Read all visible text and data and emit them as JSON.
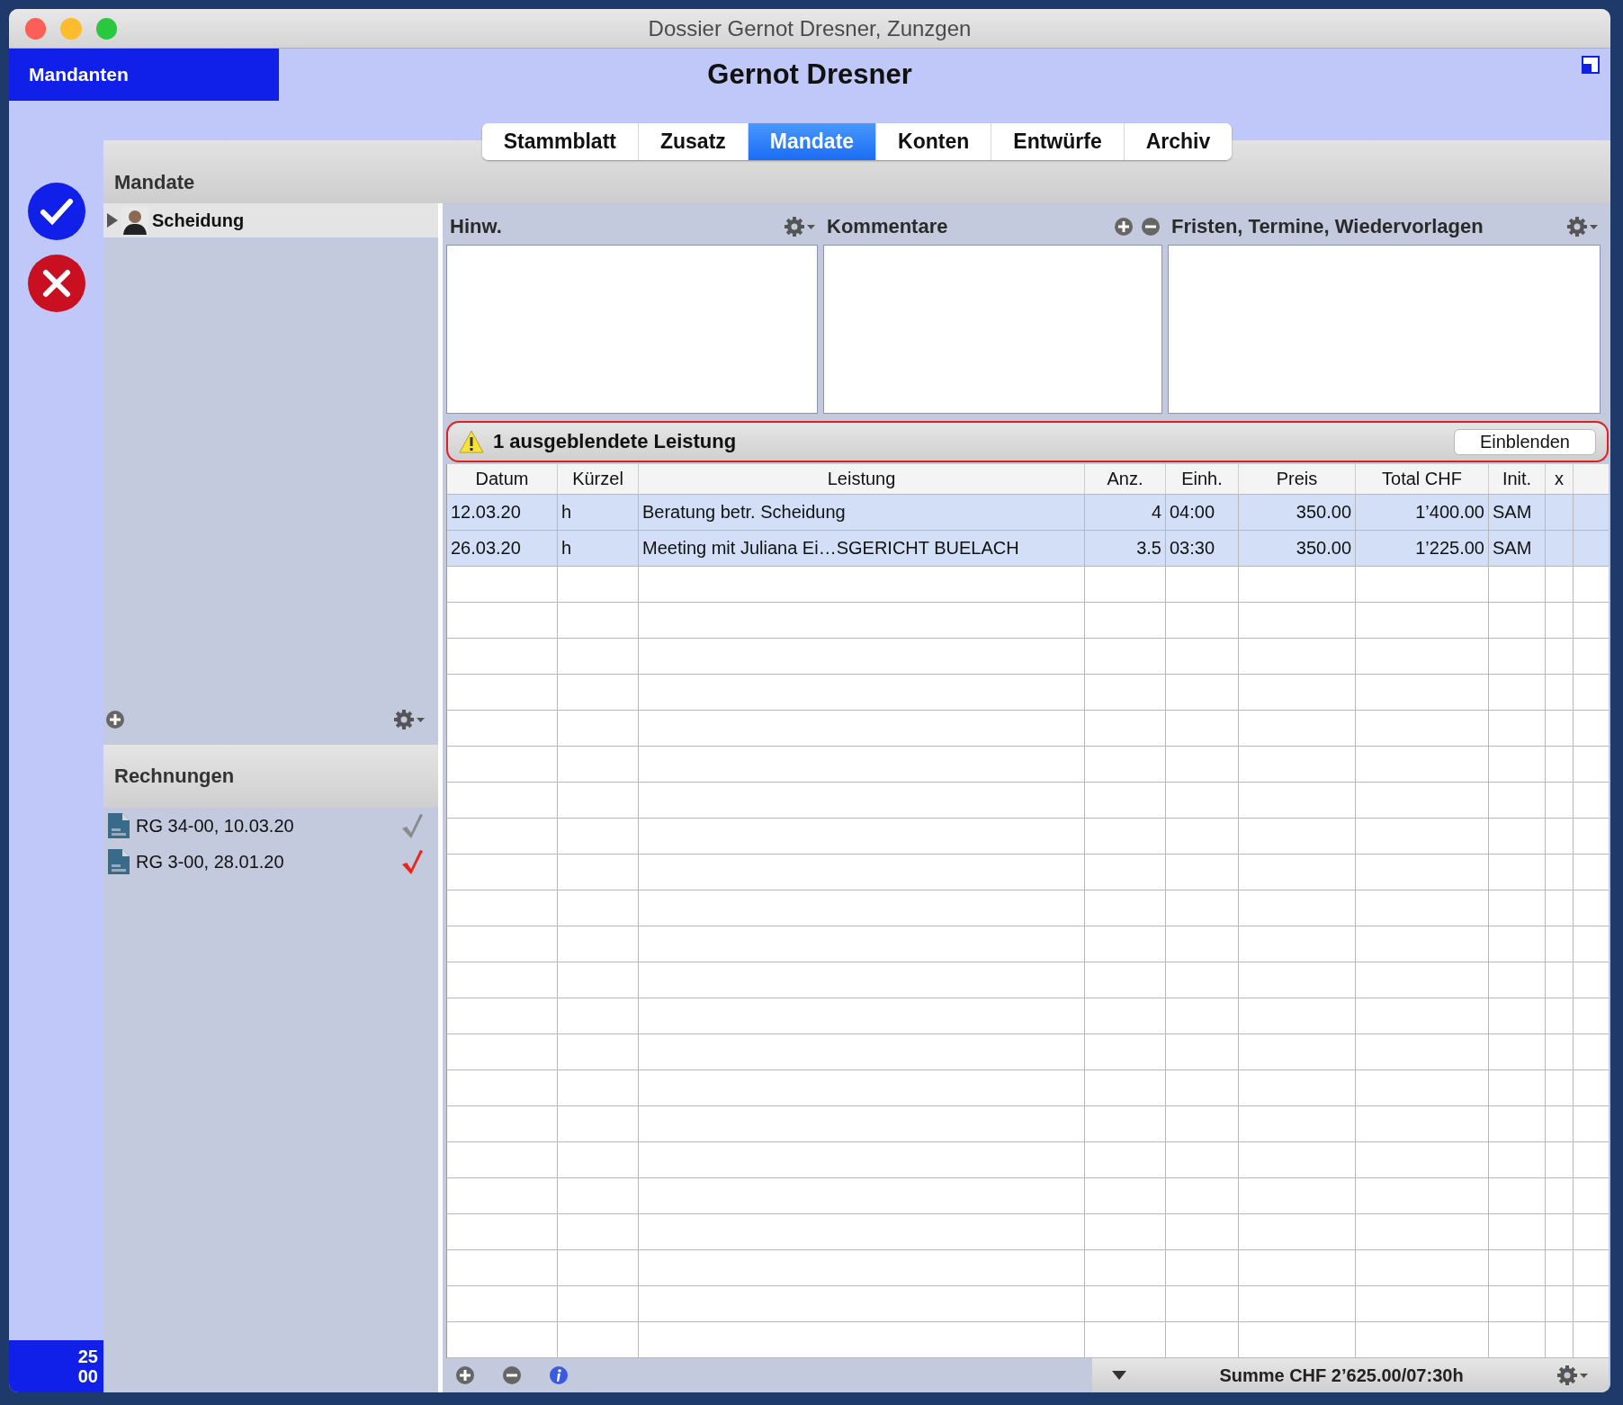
{
  "window": {
    "title": "Dossier Gernot Dresner, Zunzgen"
  },
  "nav": {
    "label": "Mandanten"
  },
  "client_name": "Gernot Dresner",
  "counter": [
    "25",
    "00"
  ],
  "tabs": [
    {
      "label": "Stammblatt",
      "selected": false
    },
    {
      "label": "Zusatz",
      "selected": false
    },
    {
      "label": "Mandate",
      "selected": true
    },
    {
      "label": "Konten",
      "selected": false
    },
    {
      "label": "Entwürfe",
      "selected": false
    },
    {
      "label": "Archiv",
      "selected": false
    }
  ],
  "mandates": {
    "title": "Mandate",
    "items": [
      {
        "label": "Scheidung",
        "selected": true
      }
    ]
  },
  "invoices": {
    "title": "Rechnungen",
    "items": [
      {
        "label": "RG 34-00, 10.03.20",
        "color": "#8a8a8a"
      },
      {
        "label": "RG 3-00, 28.01.20",
        "color": "#e8261e"
      }
    ]
  },
  "panes": [
    {
      "title": "Hinw.",
      "kind": "gear"
    },
    {
      "title": "Kommentare",
      "kind": "add-remove"
    },
    {
      "title": "Fristen, Termine, Wiedervorlagen",
      "kind": "gear"
    }
  ],
  "warning": {
    "text": "1 ausgeblendete Leistung",
    "button": "Einblenden"
  },
  "table": {
    "columns": [
      "Datum",
      "Kürzel",
      "Leistung",
      "Anz.",
      "Einh.",
      "Preis",
      "Total CHF",
      "Init.",
      "x"
    ],
    "rows": [
      {
        "selected": true,
        "cells": [
          "12.03.20",
          "h",
          "Beratung betr. Scheidung",
          "4",
          "04:00",
          "350.00",
          "1’400.00",
          "SAM",
          ""
        ]
      },
      {
        "selected": true,
        "cells": [
          "26.03.20",
          "h",
          "Meeting mit Juliana Ei…SGERICHT BUELACH",
          "3.5",
          "03:30",
          "350.00",
          "1’225.00",
          "SAM",
          ""
        ]
      }
    ]
  },
  "footer": {
    "sum": "Summe CHF 2’625.00/07:30h"
  }
}
